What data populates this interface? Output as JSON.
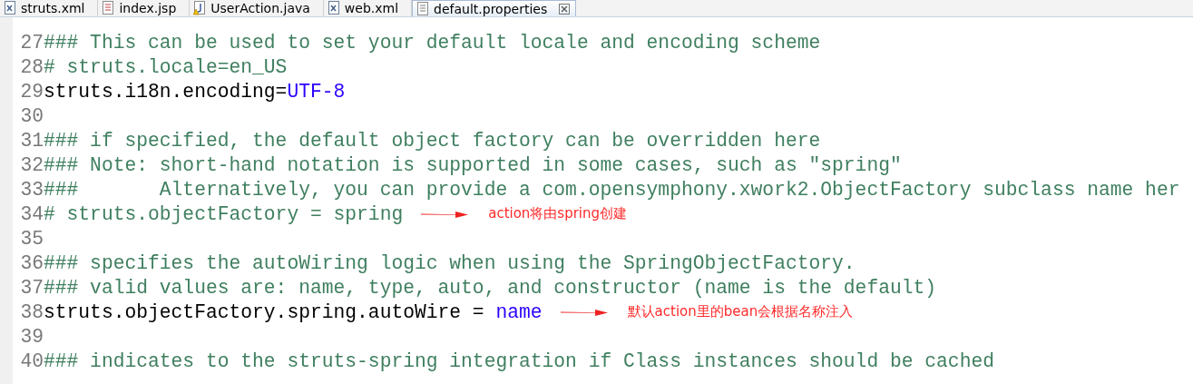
{
  "tabs": [
    {
      "label": "struts.xml",
      "kind": "xml",
      "selected": false
    },
    {
      "label": "index.jsp",
      "kind": "jsp",
      "selected": false
    },
    {
      "label": "UserAction.java",
      "kind": "java",
      "selected": false
    },
    {
      "label": "web.xml",
      "kind": "xml",
      "selected": false
    },
    {
      "label": "default.properties",
      "kind": "properties",
      "selected": true
    }
  ],
  "lines": [
    {
      "number": "27",
      "segments": [
        {
          "kind": "comment",
          "text": "### This can be used to set your default locale and encoding scheme"
        }
      ]
    },
    {
      "number": "28",
      "segments": [
        {
          "kind": "comment",
          "text": "# struts.locale=en_US"
        }
      ]
    },
    {
      "number": "29",
      "segments": [
        {
          "kind": "key",
          "text": "struts.i18n.encoding="
        },
        {
          "kind": "value",
          "text": "UTF-8"
        }
      ]
    },
    {
      "number": "30"
    },
    {
      "number": "31",
      "segments": [
        {
          "kind": "comment",
          "text": "### if specified, the default object factory can be overridden here"
        }
      ]
    },
    {
      "number": "32",
      "segments": [
        {
          "kind": "comment",
          "text": "### Note: short-hand notation is supported in some cases, such as \"spring\""
        }
      ]
    },
    {
      "number": "33",
      "segments": [
        {
          "kind": "comment",
          "text": "###       Alternatively, you can provide a com.opensymphony.xwork2.ObjectFactory subclass name her"
        }
      ]
    },
    {
      "number": "34",
      "segments": [
        {
          "kind": "comment",
          "text": "# struts.objectFactory = spring"
        }
      ],
      "note": "action将由spring创建"
    },
    {
      "number": "35"
    },
    {
      "number": "36",
      "segments": [
        {
          "kind": "comment",
          "text": "### specifies the autoWiring logic when using the SpringObjectFactory."
        }
      ]
    },
    {
      "number": "37",
      "segments": [
        {
          "kind": "comment",
          "text": "### valid values are: name, type, auto, and constructor (name is the default)"
        }
      ]
    },
    {
      "number": "38",
      "segments": [
        {
          "kind": "key",
          "text": "struts.objectFactory.spring.autoWire = "
        },
        {
          "kind": "value",
          "text": "name"
        }
      ],
      "note": "默认action里的bean会根据名称注入"
    },
    {
      "number": "39"
    },
    {
      "number": "40",
      "segments": [
        {
          "kind": "comment",
          "text": "### indicates to the struts-spring integration if Class instances should be cached"
        }
      ]
    }
  ]
}
